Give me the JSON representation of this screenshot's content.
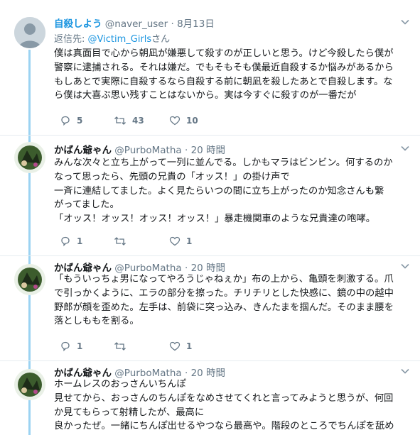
{
  "tweets": [
    {
      "display_name": "自殺しよう",
      "handle": "@naver_user",
      "time": "8月13日",
      "reply_label": "返信先: ",
      "reply_handle": "@Victim_Girls",
      "reply_suffix": "さん",
      "lines": [
        "僕は真面目で心から朝凪が嫌悪して殺すのが正しいと思う。けど今殺したら僕が",
        "警察に逮捕される。それは嫌だ。でもそもそも僕最近自殺するか悩みがあるから",
        "もしあとで実際に自殺するなら自殺する前に朝凪を殺したあとで自殺します。な",
        "ら僕は大喜ぶ思い残すことはないから。実は今すぐに殺すのが一番だが"
      ],
      "replies": "5",
      "retweets": "43",
      "likes": "10"
    },
    {
      "display_name": "かばん爺ゃん",
      "handle": "@PurboMatha",
      "time": "20 時間",
      "lines": [
        "みんな次々と立ち上がって一列に並んでる。しかもマラはビンビン。何するのか",
        "なって思ったら、先頭の兄貴の「オッス！」の掛け声で",
        "一斉に連結してました。よく見たらいつの間に立ち上がったのか知念さんも繋",
        "がってました。",
        "「オッス！オッス！オッス！オッス！」暴走機関車のような兄貴達の咆哮。"
      ],
      "replies": "1",
      "retweets": "",
      "likes": "1"
    },
    {
      "display_name": "かばん爺ゃん",
      "handle": "@PurboMatha",
      "time": "20 時間",
      "lines": [
        "「もういっちょ男になってやろうじゃねぇか」布の上から、亀頭を刺激する。爪",
        "で引っかくように、エラの部分を擦った。チリチリとした快感に、鏡の中の越中",
        "野郎が顔を歪めた。左手は、前袋に突っ込み、きんたまを掴んだ。そのまま腰を",
        "落としももを割る。"
      ],
      "replies": "1",
      "retweets": "",
      "likes": "1"
    },
    {
      "display_name": "かばん爺ゃん",
      "handle": "@PurboMatha",
      "time": "20 時間",
      "lines": [
        "ホームレスのおっさんいちんぽ",
        "見せてから、おっさんのちんぽをなめさせてくれと言ってみようと思うが、何回",
        "か見てもらって射精したが、最高に",
        "良かったぜ。一緒にちんぽ出せるやつなら最高や。階段のところでちんぽを舐め"
      ]
    }
  ],
  "icons": {
    "reply": "reply-icon",
    "retweet": "retweet-icon",
    "like": "heart-icon",
    "menu": "chevron-down-icon"
  },
  "colors": {
    "link": "#1b95e0",
    "meta": "#657786",
    "thread": "#9bd3f2"
  }
}
